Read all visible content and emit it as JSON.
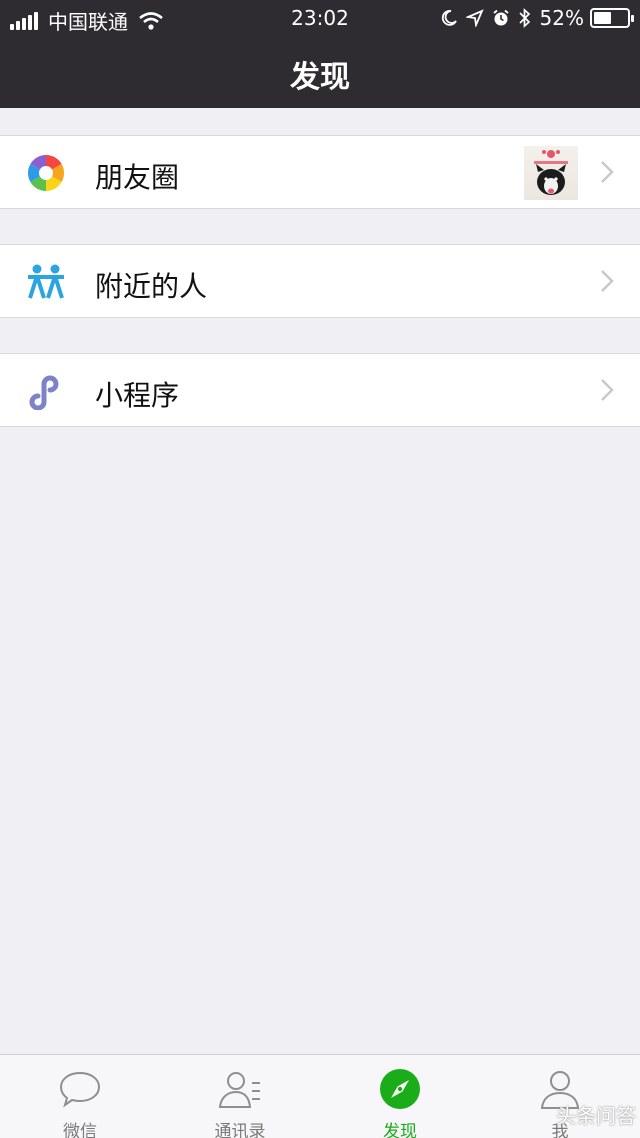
{
  "status_bar": {
    "carrier": "中国联通",
    "time": "23:02",
    "battery_percent_text": "52%",
    "battery_level": 0.52,
    "icons": [
      "signal-icon",
      "wifi-icon",
      "moon-icon",
      "location-icon",
      "alarm-icon",
      "bluetooth-icon",
      "battery-icon"
    ]
  },
  "header": {
    "title": "发现"
  },
  "menu": [
    {
      "label": "朋友圈",
      "icon": "moments-aperture-icon"
    },
    {
      "label": "附近的人",
      "icon": "people-nearby-icon"
    },
    {
      "label": "小程序",
      "icon": "mini-program-icon"
    }
  ],
  "tabbar": [
    {
      "label": "微信",
      "icon": "chat-bubble-icon",
      "active": false
    },
    {
      "label": "通讯录",
      "icon": "contacts-icon",
      "active": false
    },
    {
      "label": "发现",
      "icon": "compass-icon",
      "active": true
    },
    {
      "label": "我",
      "icon": "person-icon",
      "active": false
    }
  ],
  "watermark": "头条问答",
  "colors": {
    "nav_bg": "#2e2c31",
    "page_bg": "#efeff4",
    "accent_green": "#1aad19",
    "people_blue": "#2aa5e0",
    "mini_program_purple": "#7c83c9"
  }
}
